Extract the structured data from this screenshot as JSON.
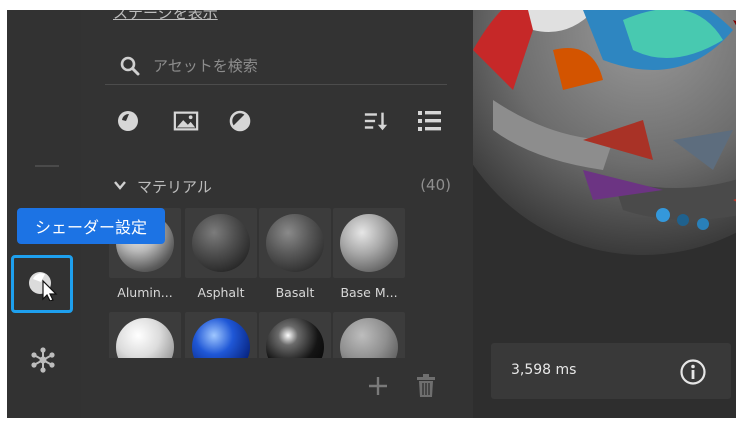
{
  "panel": {
    "back_link": "ステージを表示",
    "search_placeholder": "アセットを検索",
    "section_title": "マテリアル",
    "section_count": "(40)"
  },
  "tooltip": "シェーダー設定",
  "materials": [
    {
      "label": "Alumin..."
    },
    {
      "label": "Asphalt"
    },
    {
      "label": "Basalt"
    },
    {
      "label": "Base M..."
    },
    {
      "label": ""
    },
    {
      "label": ""
    },
    {
      "label": ""
    },
    {
      "label": ""
    }
  ],
  "stats": {
    "render_time": "3,598 ms"
  },
  "icons": {
    "toolbar": [
      "shader-settings-icon",
      "node-graph-icon"
    ],
    "filters": [
      "material-filter-icon",
      "image-filter-icon",
      "light-filter-icon",
      "sort-icon",
      "list-view-icon"
    ],
    "footer": [
      "add-icon",
      "trash-icon"
    ]
  },
  "colors": {
    "accent": "#1c73e4",
    "selection": "#1ea0ee"
  }
}
